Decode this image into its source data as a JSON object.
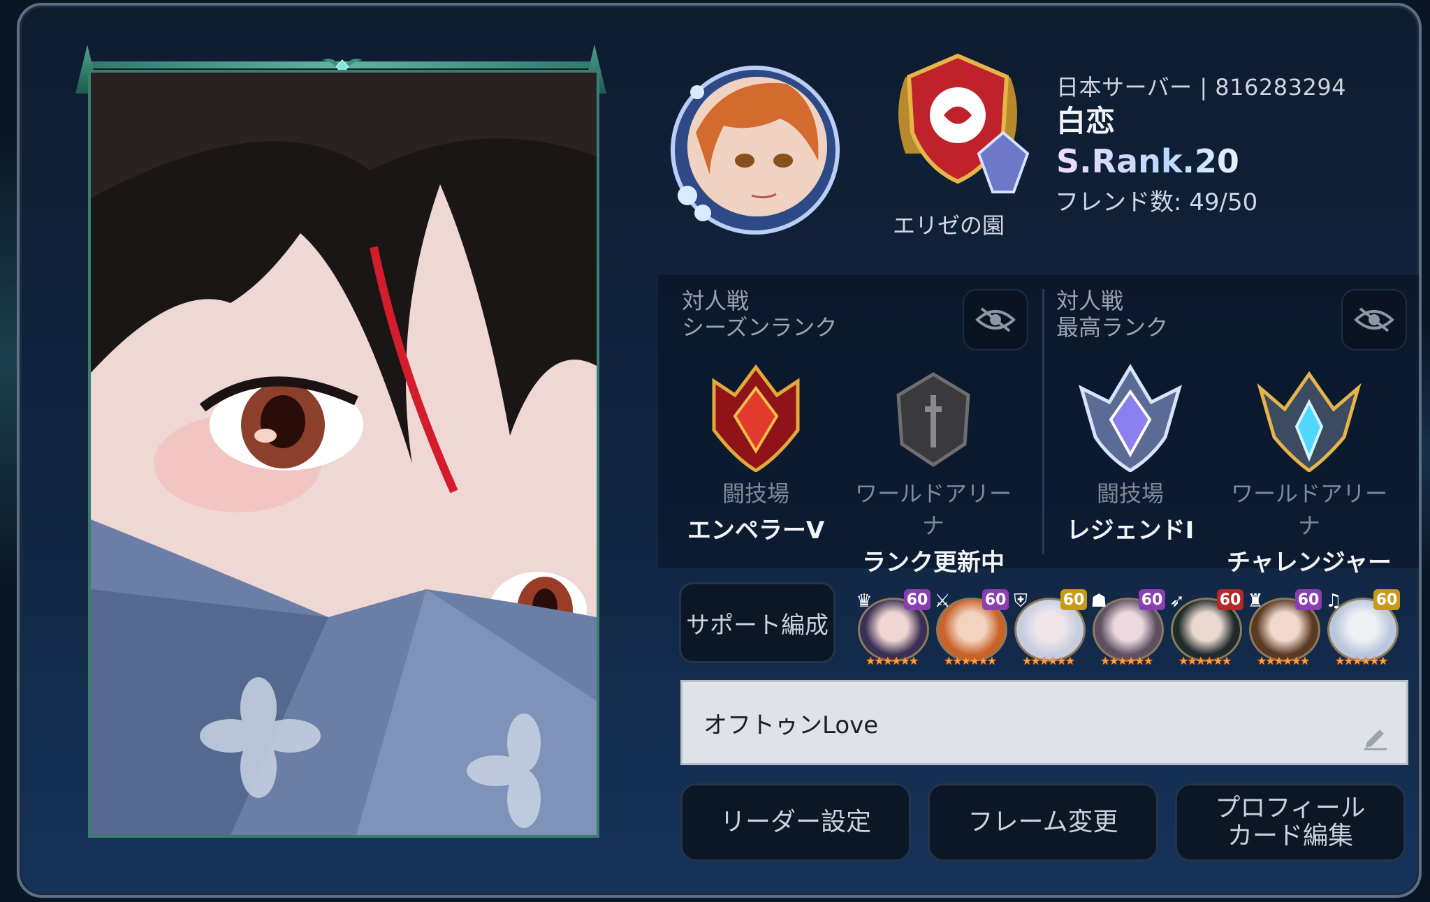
{
  "profile": {
    "server": "日本サーバー | 816283294",
    "name": "白恋",
    "s_rank": "S.Rank.20",
    "friends": "フレンド数: 49/50",
    "guild": "エリゼの園"
  },
  "season_rank": {
    "title_line1": "対人戦",
    "title_line2": "シーズンランク",
    "items": [
      {
        "category": "闘技場",
        "value": "エンペラーⅤ"
      },
      {
        "category": "ワールドアリーナ",
        "value": "ランク更新中"
      }
    ]
  },
  "best_rank": {
    "title_line1": "対人戦",
    "title_line2": "最高ランク",
    "items": [
      {
        "category": "闘技場",
        "value": "レジェンドⅠ"
      },
      {
        "category": "ワールドアリーナ",
        "value": "チャレンジャー"
      }
    ]
  },
  "support": {
    "button": "サポート編成",
    "units": [
      {
        "level": "60",
        "class_icon": "crown-icon",
        "level_color": "#8a3fb0"
      },
      {
        "level": "60",
        "class_icon": "sword-icon",
        "level_color": "#8a3fb0"
      },
      {
        "level": "60",
        "class_icon": "shield-icon",
        "level_color": "#c79a18"
      },
      {
        "level": "60",
        "class_icon": "hood-icon",
        "level_color": "#8a3fb0"
      },
      {
        "level": "60",
        "class_icon": "bow-icon",
        "level_color": "#b02a2a"
      },
      {
        "level": "60",
        "class_icon": "hat-icon",
        "level_color": "#8a3fb0"
      },
      {
        "level": "60",
        "class_icon": "note-icon",
        "level_color": "#c79a18"
      }
    ]
  },
  "comment": "オフトゥンLove",
  "buttons": {
    "leader": "リーダー設定",
    "frame": "フレーム変更",
    "card_line1": "プロフィール",
    "card_line2": "カード編集"
  }
}
